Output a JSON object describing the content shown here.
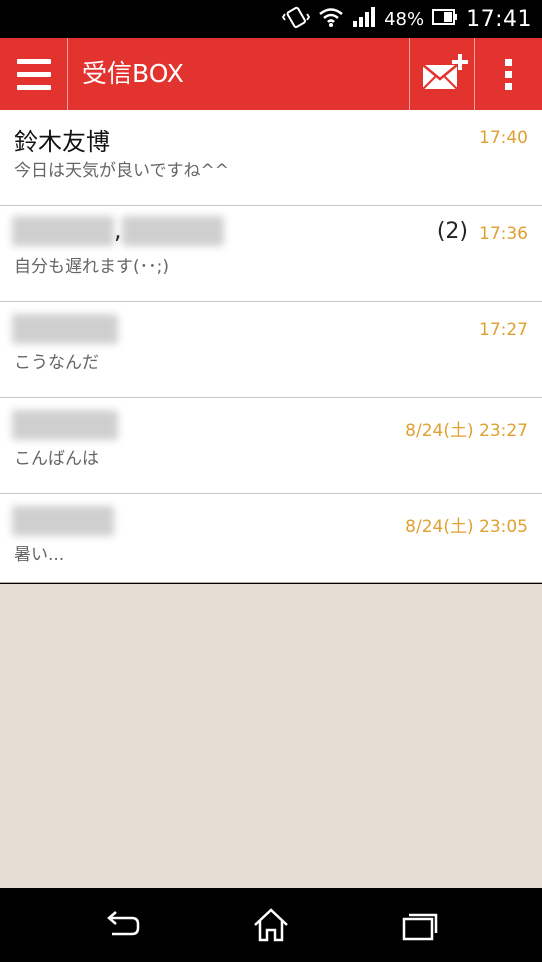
{
  "status_bar": {
    "battery_percent": "48%",
    "time": "17:41",
    "icons": [
      "vibrate-icon",
      "wifi-icon",
      "signal-icon",
      "battery-icon"
    ]
  },
  "app_bar": {
    "title": "受信BOX",
    "background": "#e3332f",
    "icons": [
      "menu-icon",
      "compose-mail-icon",
      "overflow-menu-icon"
    ]
  },
  "messages": [
    {
      "sender": "鈴木友博",
      "preview": "今日は天気が良いですね^^",
      "time": "17:40",
      "count": ""
    },
    {
      "sender": "",
      "preview": "自分も遅れます(･･;)",
      "time": "17:36",
      "count": "(2)"
    },
    {
      "sender": "",
      "preview": "こうなんだ",
      "time": "17:27",
      "count": ""
    },
    {
      "sender": "",
      "preview": "こんばんは",
      "time": "8/24(土) 23:27",
      "count": ""
    },
    {
      "sender": "",
      "preview": "暑い...",
      "time": "8/24(土) 23:05",
      "count": ""
    }
  ],
  "colors": {
    "accent": "#e3332f",
    "time_text": "#e0a030",
    "empty_background": "#e6ddd5"
  },
  "nav_bar": {
    "icons": [
      "back-icon",
      "home-icon",
      "recents-icon"
    ]
  }
}
